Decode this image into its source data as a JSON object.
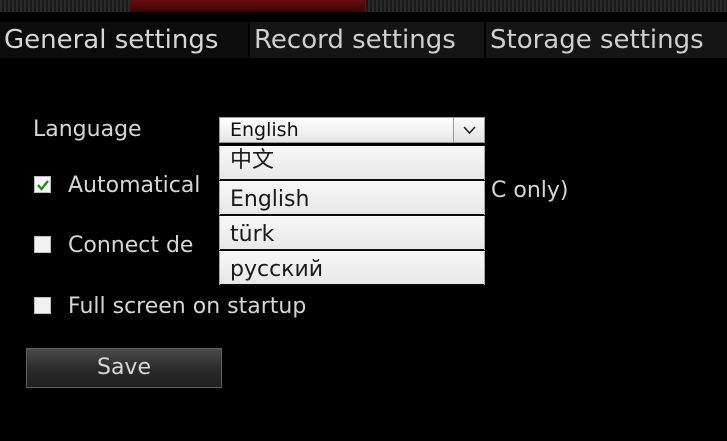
{
  "tabs": [
    {
      "label": "General settings",
      "active": true
    },
    {
      "label": "Record settings",
      "active": false
    },
    {
      "label": "Storage settings",
      "active": false
    }
  ],
  "language": {
    "label": "Language",
    "selected": "English",
    "options": [
      "中文",
      "English",
      "türk",
      "русский"
    ]
  },
  "options": {
    "auto_label_left": "Automatical",
    "auto_label_right": "C only)",
    "auto_checked": true,
    "connect_label": "Connect de",
    "connect_checked": false,
    "fullscreen_label": "Full screen on startup",
    "fullscreen_checked": false
  },
  "save_label": "Save",
  "colors": {
    "background": "#000000",
    "text": "#d6d6d6",
    "checkmark": "#2a8a2a",
    "accent_strip": "#6a0d0d"
  }
}
